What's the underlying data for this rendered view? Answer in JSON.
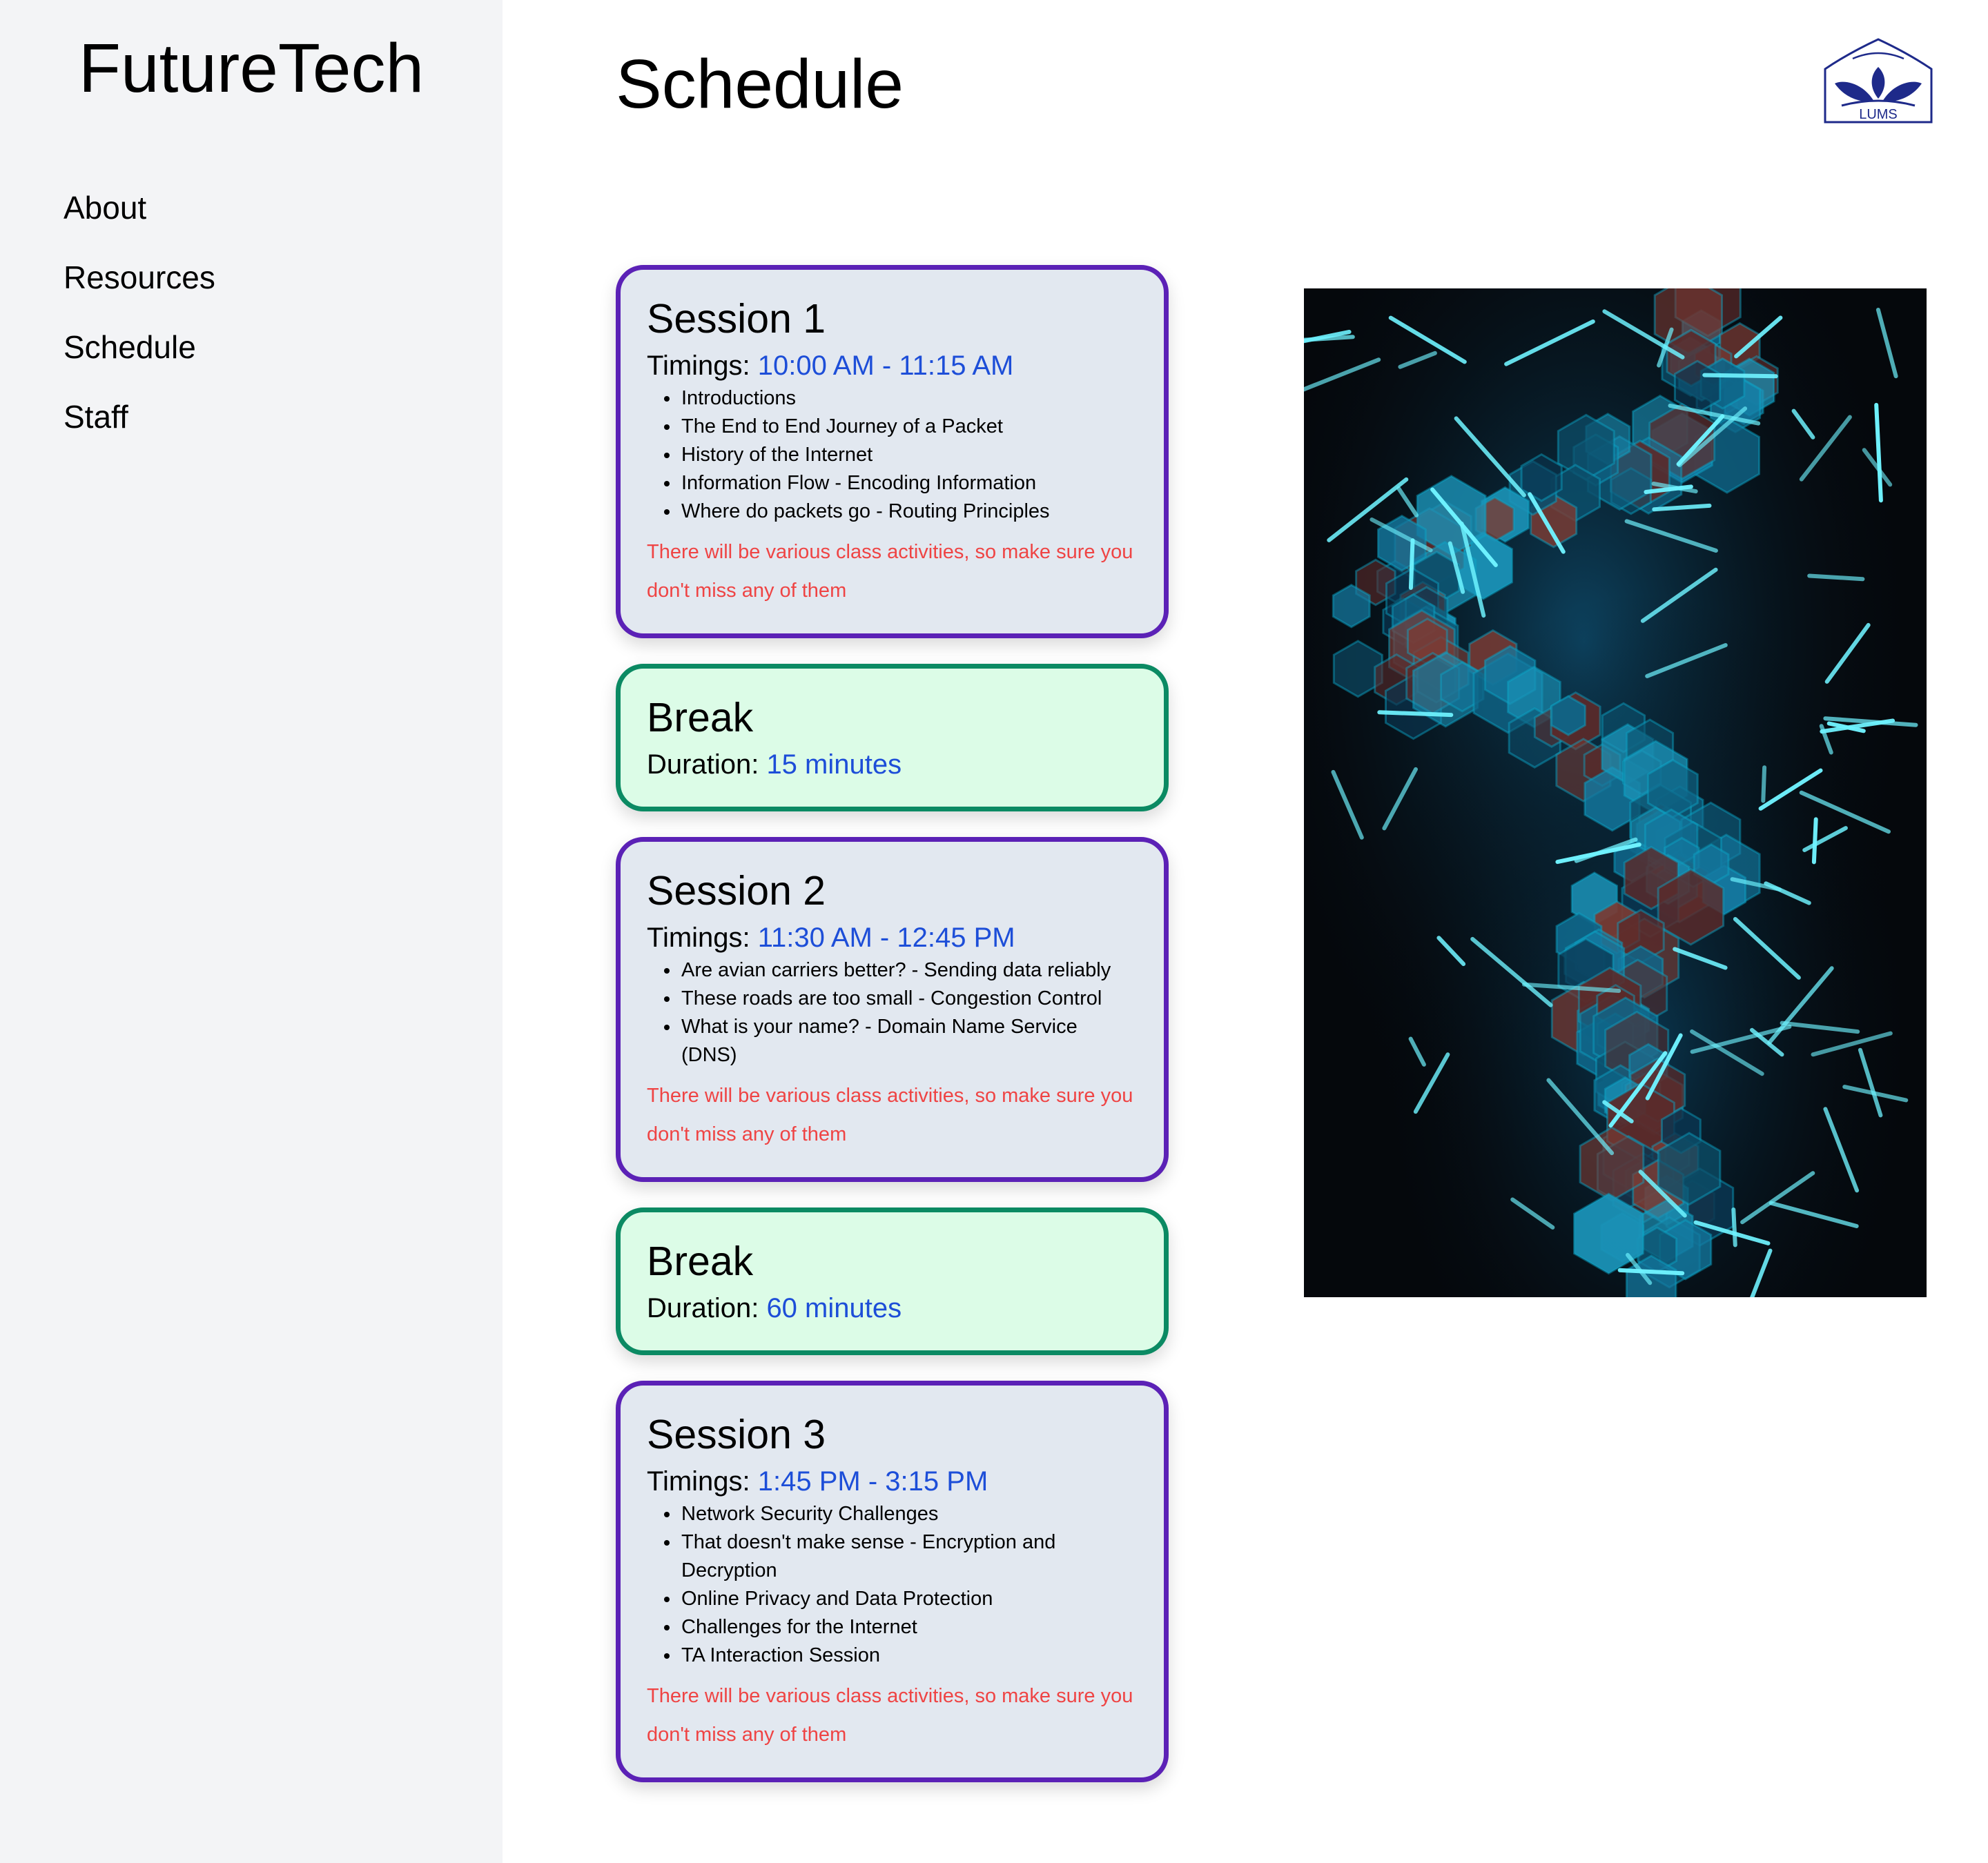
{
  "brand": "FutureTech",
  "nav": [
    "About",
    "Resources",
    "Schedule",
    "Staff"
  ],
  "page_title": "Schedule",
  "logo_text": "LUMS",
  "colors": {
    "sidebar_bg": "#f3f4f6",
    "session_border": "#5b21b6",
    "session_bg": "#e2e8f0",
    "break_border": "#0b8a63",
    "break_bg": "#dcfce7",
    "accent_value": "#1d4ed8",
    "note": "#ef4444"
  },
  "schedule": [
    {
      "title": "Session 1",
      "meta_label": "Timings:",
      "meta_value": "10:00 AM - 11:15 AM",
      "topics": [
        "Introductions",
        "The End to End Journey of a Packet",
        "History of the Internet",
        "Information Flow - Encoding Information",
        "Where do packets go - Routing Principles"
      ],
      "note": "There will be various class activities, so make sure you don't miss any of them"
    },
    {
      "title": "Break",
      "meta_label": "Duration:",
      "meta_value": "15 minutes"
    },
    {
      "title": "Session 2",
      "meta_label": "Timings:",
      "meta_value": "11:30 AM - 12:45 PM",
      "topics": [
        "Are avian carriers better? - Sending data reliably",
        "These roads are too small - Congestion Control",
        "What is your name? - Domain Name Service (DNS)"
      ],
      "note": "There will be various class activities, so make sure you don't miss any of them"
    },
    {
      "title": "Break",
      "meta_label": "Duration:",
      "meta_value": "60 minutes"
    },
    {
      "title": "Session 3",
      "meta_label": "Timings:",
      "meta_value": "1:45 PM - 3:15 PM",
      "topics": [
        "Network Security Challenges",
        "That doesn't make sense - Encryption and Decryption",
        "Online Privacy and Data Protection",
        "Challenges for the Internet",
        "TA Interaction Session"
      ],
      "note": "There will be various class activities, so make sure you don't miss any of them"
    }
  ]
}
